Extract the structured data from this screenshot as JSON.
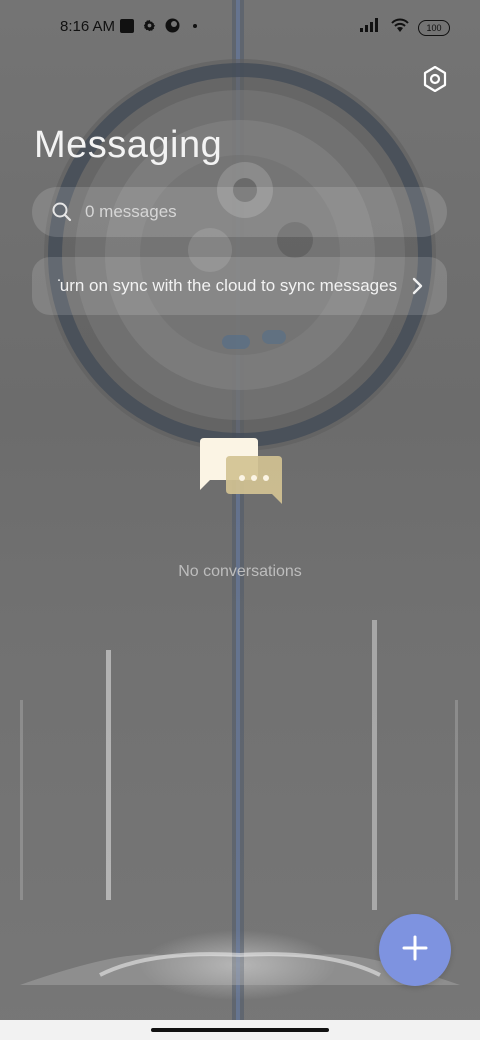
{
  "status_bar": {
    "time": "8:16 AM",
    "battery": "100",
    "icons": [
      "notification-square-icon",
      "settings-gear-icon",
      "app-notification-icon",
      "dot-icon",
      "signal-icon",
      "wifi-icon",
      "battery-icon"
    ]
  },
  "header": {
    "title": "Messaging",
    "settings_icon": "settings-hexagon-icon"
  },
  "search": {
    "placeholder": "0 messages",
    "icon": "search-icon"
  },
  "sync_banner": {
    "text": "Turn on sync with the cloud to sync messages",
    "icon": "chevron-right-icon"
  },
  "empty_state": {
    "icon": "chat-bubbles-icon",
    "text": "No conversations"
  },
  "fab": {
    "icon": "plus-icon",
    "color": "#7e93e0"
  }
}
